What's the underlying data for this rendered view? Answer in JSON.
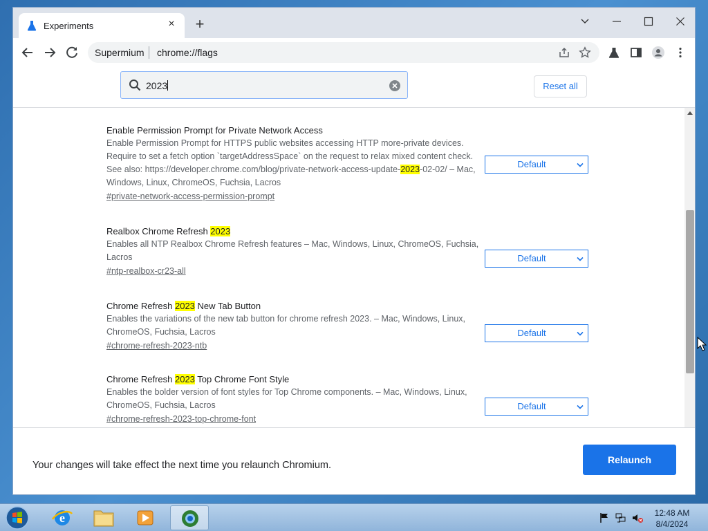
{
  "browser": {
    "tab_title": "Experiments",
    "tab_close": "×",
    "new_tab": "+",
    "origin_label": "Supermium",
    "url": "chrome://flags"
  },
  "flags_page": {
    "search_value": "2023",
    "reset_label": "Reset all",
    "flags": [
      {
        "title_parts": [
          "Enable Permission Prompt for Private Network Access",
          "",
          ""
        ],
        "desc_parts": [
          "Enable Permission Prompt for HTTPS public websites accessing HTTP more-private devices. Require to set a fetch option `targetAddressSpace` on the request to relax mixed content check. See also: https://developer.chrome.com/blog/private-network-access-update-",
          "2023",
          "-02-02/ – Mac, Windows, Linux, ChromeOS, Fuchsia, Lacros"
        ],
        "link": "#private-network-access-permission-prompt",
        "value": "Default"
      },
      {
        "title_parts": [
          "Realbox Chrome Refresh ",
          "2023",
          ""
        ],
        "desc_parts": [
          "Enables all NTP Realbox Chrome Refresh features – Mac, Windows, Linux, ChromeOS, Fuchsia, Lacros",
          "",
          ""
        ],
        "link": "#ntp-realbox-cr23-all",
        "value": "Default"
      },
      {
        "title_parts": [
          "Chrome Refresh ",
          "2023",
          " New Tab Button"
        ],
        "desc_parts": [
          "Enables the variations of the new tab button for chrome refresh 2023. – Mac, Windows, Linux, ChromeOS, Fuchsia, Lacros",
          "",
          ""
        ],
        "link": "#chrome-refresh-2023-ntb",
        "value": "Default"
      },
      {
        "title_parts": [
          "Chrome Refresh ",
          "2023",
          " Top Chrome Font Style"
        ],
        "desc_parts": [
          "Enables the bolder version of font styles for Top Chrome components. – Mac, Windows, Linux, ChromeOS, Fuchsia, Lacros",
          "",
          ""
        ],
        "link": "#chrome-refresh-2023-top-chrome-font",
        "value": "Default"
      }
    ],
    "footer_message": "Your changes will take effect the next time you relaunch Chromium.",
    "relaunch_label": "Relaunch"
  },
  "taskbar": {
    "time": "12:48 AM",
    "date": "8/4/2024"
  },
  "colors": {
    "accent": "#1a73e8",
    "highlight": "#ffff00"
  }
}
